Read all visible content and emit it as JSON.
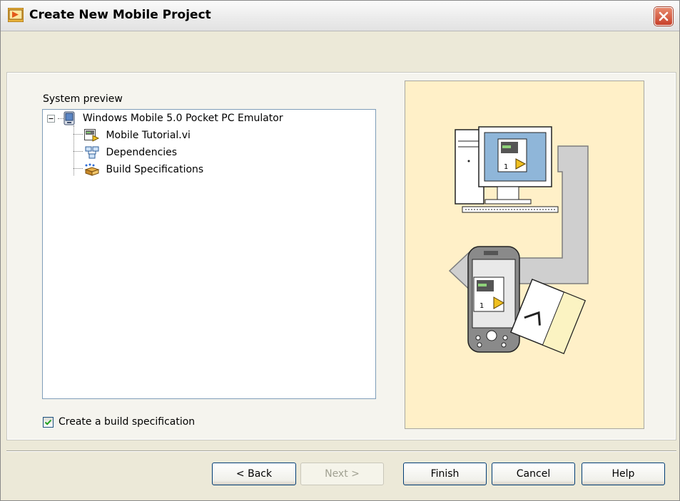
{
  "window": {
    "title": "Create New Mobile Project"
  },
  "system_preview": {
    "label": "System preview",
    "tree": [
      {
        "label": "Windows Mobile 5.0 Pocket PC Emulator",
        "icon": "pda-target-icon",
        "expanded": true
      },
      {
        "label": "Mobile Tutorial.vi",
        "icon": "vi-file-icon"
      },
      {
        "label": "Dependencies",
        "icon": "dependencies-icon"
      },
      {
        "label": "Build Specifications",
        "icon": "build-specifications-icon"
      }
    ]
  },
  "options": {
    "create_build_spec_label": "Create a build specification",
    "create_build_spec_checked": true
  },
  "illustration": {
    "vi_number": "1",
    "vi_number_device": "1"
  },
  "buttons": {
    "back": "< Back",
    "next": "Next >",
    "finish": "Finish",
    "cancel": "Cancel",
    "help": "Help"
  },
  "colors": {
    "illustration_bg": "#fff0c8",
    "titlebar_close": "#c8402a",
    "dialog_bg": "#ece9d8"
  }
}
